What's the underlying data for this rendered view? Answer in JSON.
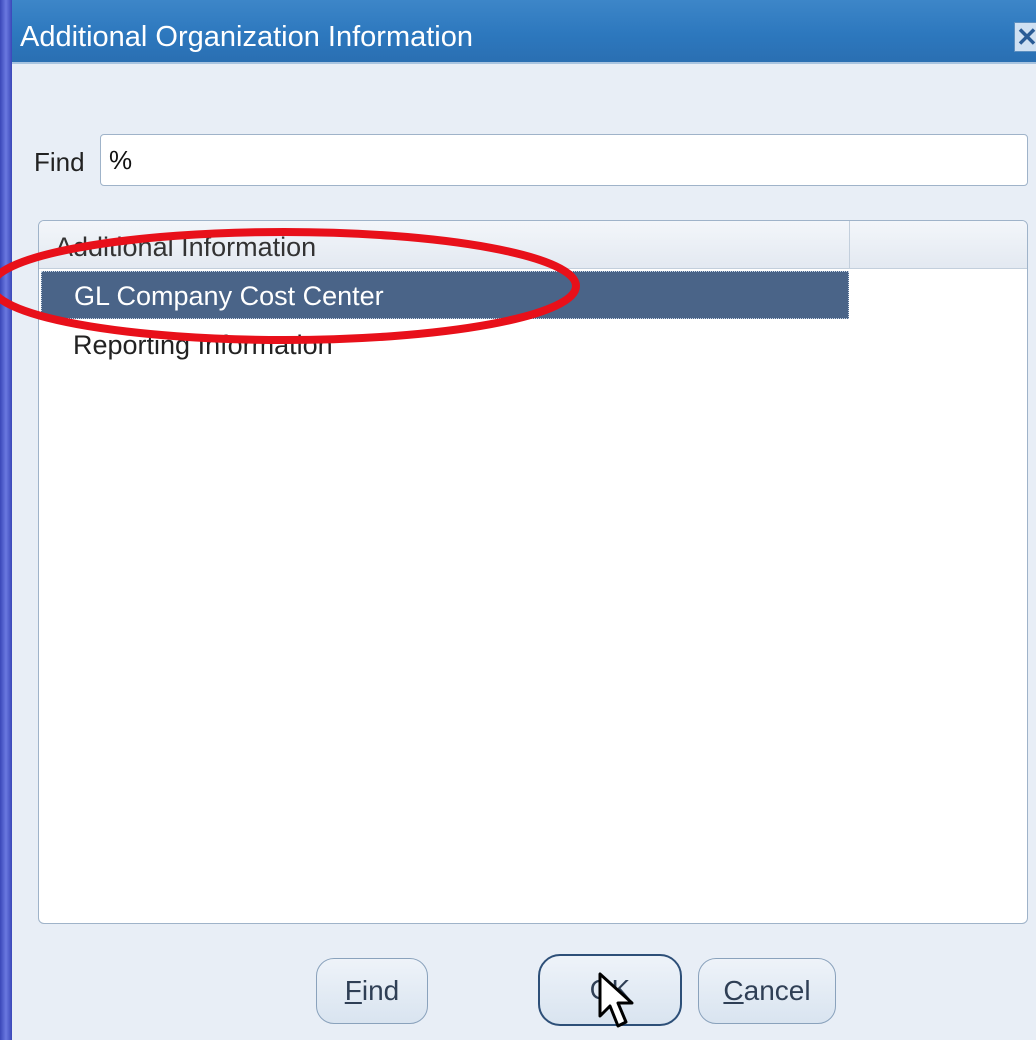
{
  "dialog": {
    "title": "Additional Organization Information",
    "close_icon": "close-icon"
  },
  "find": {
    "label": "Find",
    "value": "%"
  },
  "list": {
    "header": "Additional Information",
    "items": [
      {
        "label": "GL Company Cost Center",
        "selected": true
      },
      {
        "label": "Reporting Information",
        "selected": false
      }
    ]
  },
  "buttons": {
    "find": {
      "mnemonic": "F",
      "rest": "ind"
    },
    "ok": {
      "label": "OK"
    },
    "cancel": {
      "mnemonic": "C",
      "rest": "ancel"
    }
  },
  "colors": {
    "titlebar": "#2d78be",
    "selection": "#4a6488",
    "annotation": "#e8101a"
  },
  "overlays": {
    "annotation": "red-ellipse-highlight",
    "cursor": "mouse-pointer-icon"
  }
}
